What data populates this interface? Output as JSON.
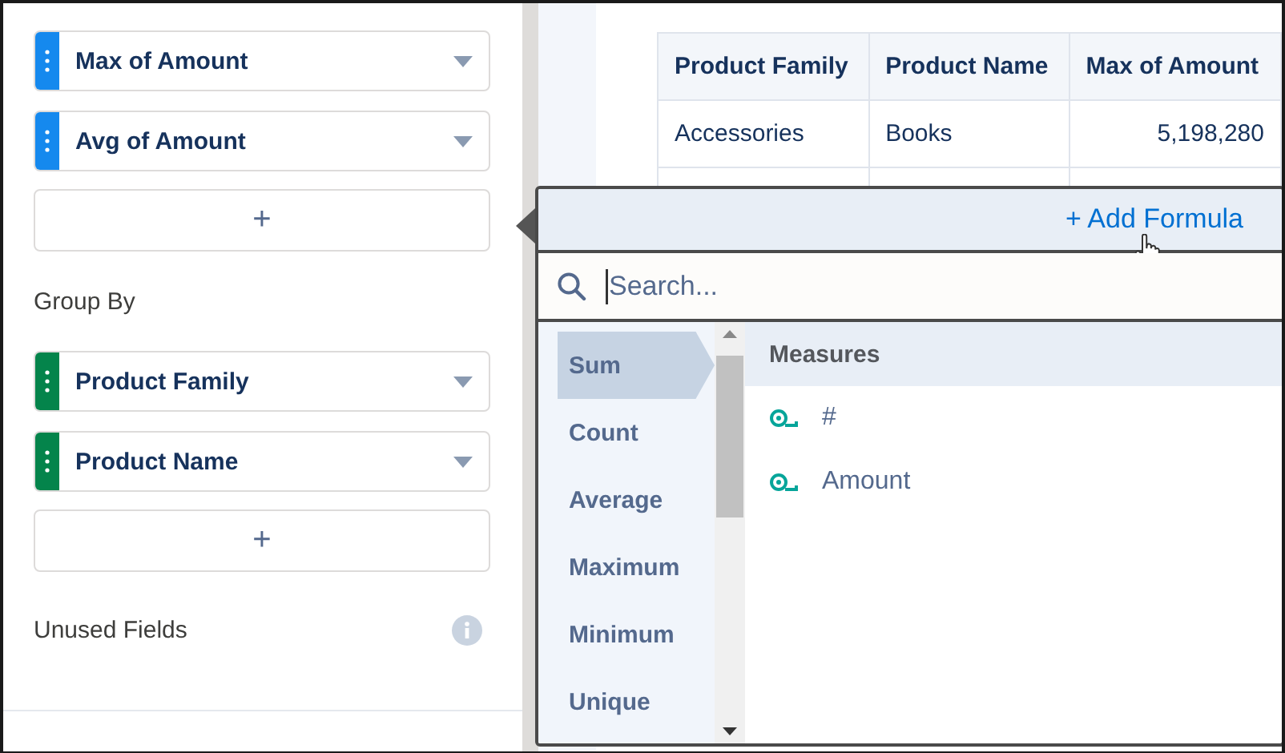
{
  "sidebar": {
    "measures": [
      {
        "label": "Max of Amount"
      },
      {
        "label": "Avg of Amount"
      }
    ],
    "measures_add": "+",
    "group_by_title": "Group By",
    "groups": [
      {
        "label": "Product Family"
      },
      {
        "label": "Product Name"
      }
    ],
    "groups_add": "+",
    "unused_fields": "Unused Fields"
  },
  "table": {
    "columns": [
      "Product Family",
      "Product Name",
      "Max of Amount"
    ],
    "rows": [
      [
        "Accessories",
        "Books",
        "5,198,280"
      ]
    ]
  },
  "popover": {
    "action": "+ Add Formula",
    "search": {
      "placeholder": "Search..."
    },
    "functions": [
      {
        "label": "Sum",
        "selected": true
      },
      {
        "label": "Count",
        "selected": false
      },
      {
        "label": "Average",
        "selected": false
      },
      {
        "label": "Maximum",
        "selected": false
      },
      {
        "label": "Minimum",
        "selected": false
      },
      {
        "label": "Unique",
        "selected": false
      }
    ],
    "section_title": "Measures",
    "fields": [
      {
        "label": "#"
      },
      {
        "label": "Amount"
      }
    ]
  }
}
